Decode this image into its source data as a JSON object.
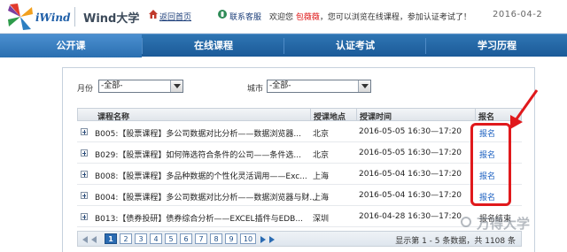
{
  "header": {
    "logo_text": "iWind",
    "site_name": "Wind大学",
    "home_label": "返回首页",
    "service_label": "联系客服",
    "welcome_prefix": "欢迎您",
    "username": "包薇薇",
    "welcome_suffix": "，您可以浏览在线课程，参加认证考试了！",
    "date": "2016-04-2"
  },
  "nav": {
    "items": [
      "公开课",
      "在线课程",
      "认证考试",
      "学习历程"
    ],
    "active": "公开课"
  },
  "filters": {
    "month_label": "月份",
    "month_value": "-全部-",
    "city_label": "城市",
    "city_value": "-全部-"
  },
  "table": {
    "headers": [
      "课程名称",
      "授课地点",
      "授课时间",
      "报名"
    ],
    "rows": [
      {
        "title": "B005:【股票课程】多公司数据对比分析——数据浏览器...",
        "location": "北京",
        "time": "2016-05-05 16:30—17:20",
        "signup": "报名"
      },
      {
        "title": "B029:【股票课程】如何筛选符合条件的公司——条件选...",
        "location": "北京",
        "time": "2016-05-05 16:30—17:20",
        "signup": "报名"
      },
      {
        "title": "B008:【股票课程】多品种数据的个性化灵活调用——Exc...",
        "location": "上海",
        "time": "2016-05-04 16:30—17:20",
        "signup": "报名"
      },
      {
        "title": "B004:【股票课程】多公司数据对比分析——数据浏览器与财...",
        "location": "上海",
        "time": "2016-05-04 16:30—17:20",
        "signup": "报名"
      },
      {
        "title": "B013:【债券投研】债券综合分析——EXCEL插件与EDB...",
        "location": "深圳",
        "time": "2016-04-28 16:30—17:20",
        "signup": "报名结束"
      }
    ]
  },
  "pager": {
    "pages": [
      "1",
      "2",
      "3",
      "4",
      "5",
      "6",
      "7",
      "8",
      "9",
      "10"
    ],
    "current": "1",
    "info": "显示第 1 - 5 条数据，共 1108 条"
  },
  "watermark": "万得大学",
  "colors": {
    "nav_bg": "#1f5f9f",
    "highlight": "#e0191c",
    "link": "#1a5fc0"
  },
  "icons": [
    "logo-pinwheel-icon",
    "home-icon",
    "phone-icon",
    "expand-icon",
    "first-page-icon",
    "prev-page-icon",
    "next-page-icon",
    "last-page-icon"
  ]
}
